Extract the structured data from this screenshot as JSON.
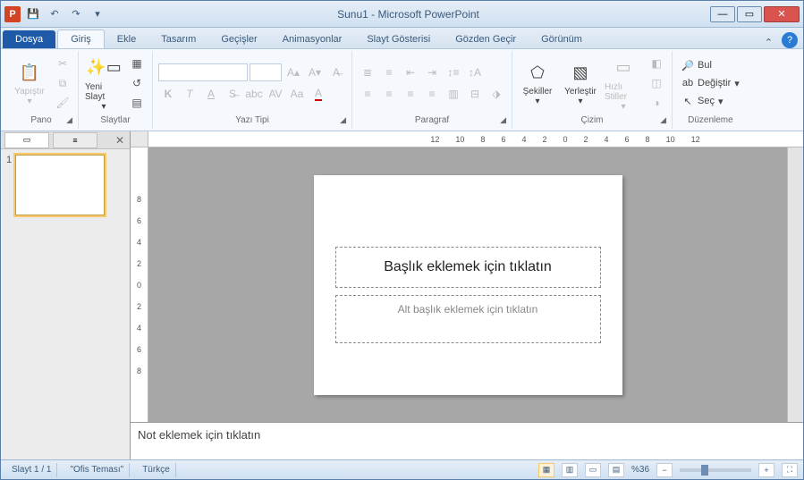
{
  "title": "Sunu1 - Microsoft PowerPoint",
  "app_letter": "P",
  "tabs": {
    "file": "Dosya",
    "home": "Giriş",
    "insert": "Ekle",
    "design": "Tasarım",
    "transitions": "Geçişler",
    "animations": "Animasyonlar",
    "slideshow": "Slayt Gösterisi",
    "review": "Gözden Geçir",
    "view": "Görünüm"
  },
  "ribbon": {
    "clipboard": {
      "label": "Pano",
      "paste": "Yapıştır"
    },
    "slides": {
      "label": "Slaytlar",
      "new_slide": "Yeni Slayt"
    },
    "font": {
      "label": "Yazı Tipi"
    },
    "paragraph": {
      "label": "Paragraf"
    },
    "drawing": {
      "label": "Çizim",
      "shapes": "Şekiller",
      "arrange": "Yerleştir",
      "quick_styles": "Hızlı Stiller"
    },
    "editing": {
      "label": "Düzenleme",
      "find": "Bul",
      "replace": "Değiştir",
      "select": "Seç"
    }
  },
  "ruler": {
    "h": [
      "12",
      "10",
      "8",
      "6",
      "4",
      "2",
      "0",
      "2",
      "4",
      "6",
      "8",
      "10",
      "12"
    ],
    "v": [
      "8",
      "6",
      "4",
      "2",
      "0",
      "2",
      "4",
      "6",
      "8"
    ]
  },
  "thumb_num": "1",
  "slide": {
    "title_placeholder": "Başlık eklemek için tıklatın",
    "subtitle_placeholder": "Alt başlık eklemek için tıklatın"
  },
  "notes_placeholder": "Not eklemek için tıklatın",
  "status": {
    "slide_info": "Slayt 1 / 1",
    "theme": "\"Ofis Teması\"",
    "language": "Türkçe",
    "zoom": "%36"
  }
}
